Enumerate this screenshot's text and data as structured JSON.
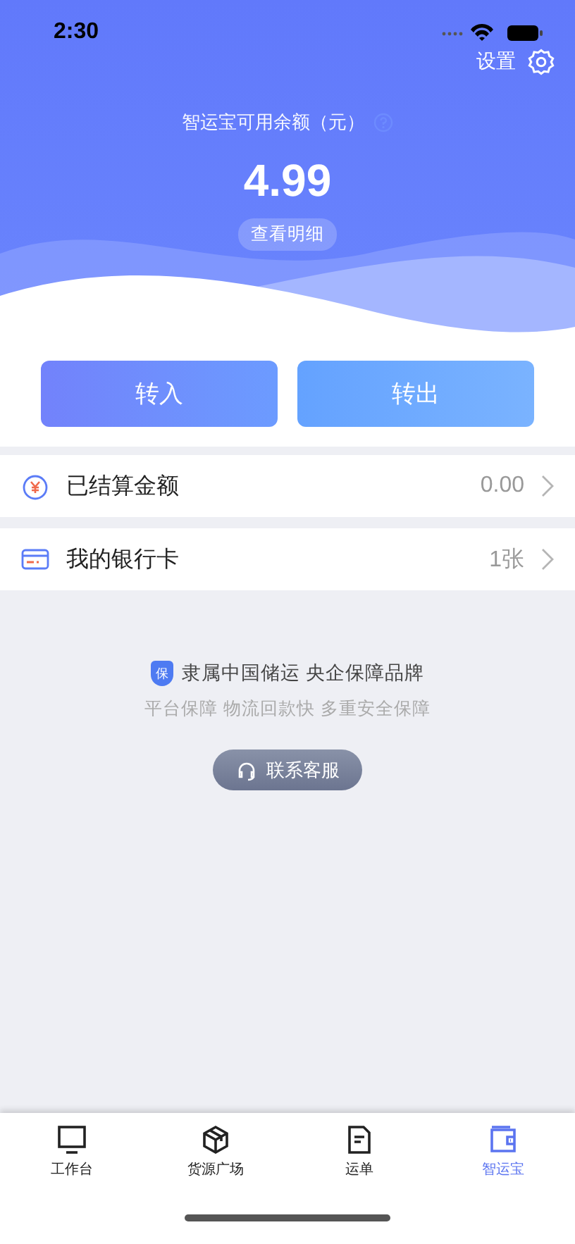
{
  "status_bar": {
    "time": "2:30"
  },
  "header": {
    "settings_label": "设置",
    "balance_label": "智运宝可用余额（元）",
    "balance": "4.99",
    "details_button": "查看明细"
  },
  "actions": [
    {
      "label": "转入",
      "kind": "in"
    },
    {
      "label": "转出",
      "kind": "out"
    }
  ],
  "rows": [
    {
      "kind": "settled",
      "label": "已结算金额",
      "value": "0.00"
    },
    {
      "kind": "card",
      "label": "我的银行卡",
      "value": "1张"
    }
  ],
  "assurance": {
    "badge": "保",
    "title": "隶属中国储运 央企保障品牌",
    "subtitle": "平台保障 物流回款快 多重安全保障",
    "service_button": "联系客服"
  },
  "tabs": [
    {
      "label": "工作台",
      "kind": "monitor",
      "selected": false
    },
    {
      "label": "货源广场",
      "kind": "box",
      "selected": false
    },
    {
      "label": "运单",
      "kind": "doc",
      "selected": false
    },
    {
      "label": "智运宝",
      "kind": "wallet",
      "selected": true
    }
  ]
}
